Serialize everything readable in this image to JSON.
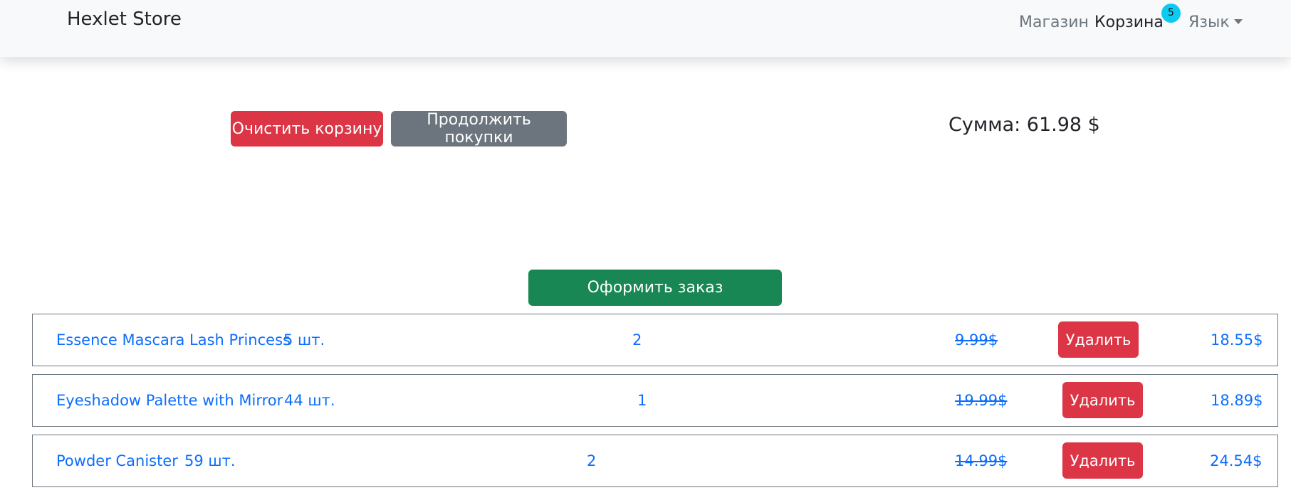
{
  "navbar": {
    "brand": "Hexlet Store",
    "shop": "Магазин",
    "cart": "Корзина",
    "cart_count": "5",
    "language": "Язык"
  },
  "actions": {
    "clear": "Очистить корзину",
    "continue": "Продолжить покупки",
    "checkout": "Оформить заказ"
  },
  "total": "Сумма: 61.98 $",
  "cart": {
    "delete_label": "Удалить",
    "items": [
      {
        "name": "Essence Mascara Lash Princess",
        "stock": "5 шт.",
        "qty": "2",
        "old_price": "9.99$",
        "sum": "18.55$"
      },
      {
        "name": "Eyeshadow Palette with Mirror",
        "stock": "44 шт.",
        "qty": "1",
        "old_price": "19.99$",
        "sum": "18.89$"
      },
      {
        "name": "Powder Canister",
        "stock": "59 шт.",
        "qty": "2",
        "old_price": "14.99$",
        "sum": "24.54$"
      }
    ]
  },
  "colors": {
    "primary": "#0d6efd",
    "danger": "#dc3545",
    "secondary": "#6c757d",
    "success": "#198754",
    "info": "#0dcaf0"
  }
}
